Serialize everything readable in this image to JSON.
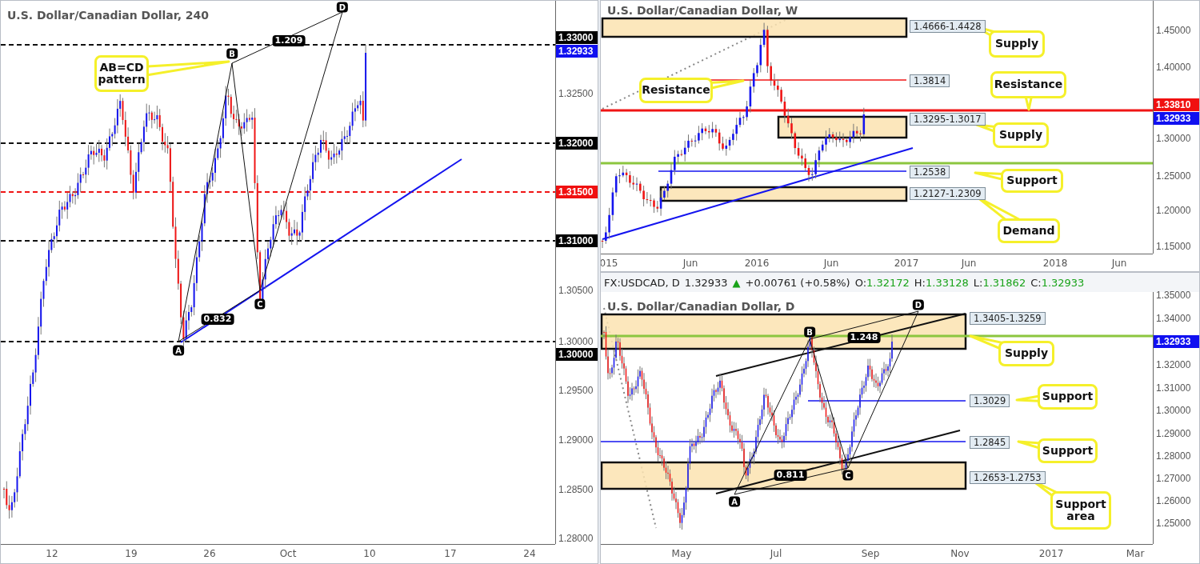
{
  "h4": {
    "title": "U.S. Dollar/Canadian Dollar, 240",
    "price_axis": [
      {
        "label": "1.33000",
        "kind": "black"
      },
      {
        "label": "1.32933",
        "kind": "blue"
      },
      {
        "label": "1.32500",
        "kind": "plain"
      },
      {
        "label": "1.32000",
        "kind": "black"
      },
      {
        "label": "1.31500",
        "kind": "red"
      },
      {
        "label": "1.31000",
        "kind": "black"
      },
      {
        "label": "1.30500",
        "kind": "plain"
      },
      {
        "label": "1.30000",
        "kind": "plain"
      },
      {
        "label": "1.30000",
        "kind": "black"
      },
      {
        "label": "1.29500",
        "kind": "plain"
      },
      {
        "label": "1.29000",
        "kind": "plain"
      },
      {
        "label": "1.28500",
        "kind": "plain"
      },
      {
        "label": "1.28000",
        "kind": "plain"
      }
    ],
    "time_axis": [
      "12",
      "19",
      "26",
      "Oct",
      "10",
      "17",
      "24"
    ],
    "pattern_points": [
      "A",
      "B",
      "C",
      "D"
    ],
    "ratios": [
      "1.209",
      "0.832"
    ],
    "callouts": [
      "AB=CD pattern"
    ]
  },
  "weekly": {
    "title": "U.S. Dollar/Canadian Dollar, W",
    "zone_labels": [
      "1.4666-1.4428",
      "1.3814",
      "1.3295-1.3017",
      "1.2538",
      "1.2127-1.2309"
    ],
    "callouts": [
      "Supply",
      "Resistance",
      "Resistance",
      "Supply",
      "Support",
      "Demand"
    ],
    "price_axis": [
      {
        "label": "1.45000",
        "kind": "plain"
      },
      {
        "label": "1.40000",
        "kind": "plain"
      },
      {
        "label": "1.33810",
        "kind": "red"
      },
      {
        "label": "1.32933",
        "kind": "blue"
      },
      {
        "label": "1.30000",
        "kind": "plain"
      },
      {
        "label": "1.25000",
        "kind": "plain"
      },
      {
        "label": "1.20000",
        "kind": "plain"
      },
      {
        "label": "1.15000",
        "kind": "plain"
      }
    ],
    "time_axis": [
      "015",
      "Jun",
      "2016",
      "Jun",
      "2017",
      "Jun",
      "2018",
      "Jun"
    ]
  },
  "daily": {
    "header": {
      "symbol": "FX:USDCAD, D",
      "price": "1.32933",
      "arrow": "▲",
      "change": "+0.00761 (+0.58%)",
      "ohlc": [
        {
          "key": "O:",
          "value": "1.32172"
        },
        {
          "key": "H:",
          "value": "1.33128"
        },
        {
          "key": "L:",
          "value": "1.31862"
        },
        {
          "key": "C:",
          "value": "1.32933"
        }
      ]
    },
    "title": "U.S. Dollar/Canadian Dollar, D",
    "zone_labels": [
      "1.3405-1.3259",
      "1.3029",
      "1.2845",
      "1.2653-1.2753"
    ],
    "pattern_points": [
      "A",
      "B",
      "C",
      "D"
    ],
    "ratios": [
      "1.248",
      "0.811"
    ],
    "callouts": [
      "Supply",
      "Support",
      "Support",
      "Support area"
    ],
    "price_axis": [
      {
        "label": "1.35000",
        "kind": "plain"
      },
      {
        "label": "1.34000",
        "kind": "plain"
      },
      {
        "label": "1.32933",
        "kind": "blue"
      },
      {
        "label": "1.32000",
        "kind": "plain"
      },
      {
        "label": "1.31000",
        "kind": "plain"
      },
      {
        "label": "1.30000",
        "kind": "plain"
      },
      {
        "label": "1.29000",
        "kind": "plain"
      },
      {
        "label": "1.28000",
        "kind": "plain"
      },
      {
        "label": "1.27000",
        "kind": "plain"
      },
      {
        "label": "1.26000",
        "kind": "plain"
      },
      {
        "label": "1.25000",
        "kind": "plain"
      }
    ],
    "time_axis": [
      "May",
      "Jul",
      "Sep",
      "Nov",
      "2017",
      "Mar"
    ]
  }
}
